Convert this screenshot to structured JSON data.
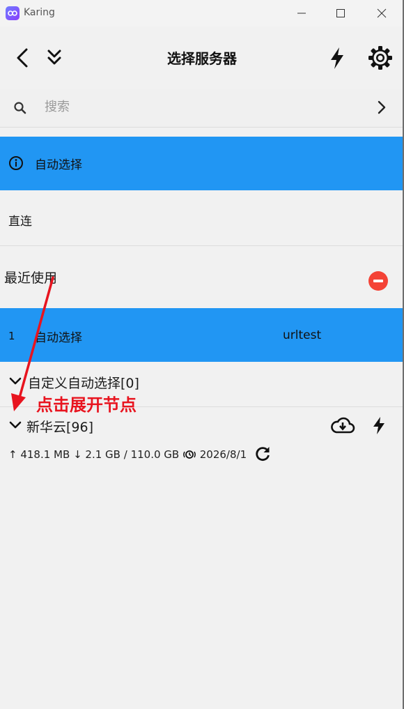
{
  "window": {
    "title": "Karing"
  },
  "header": {
    "title": "选择服务器"
  },
  "search": {
    "placeholder": "搜索"
  },
  "auto_select": {
    "label": "自动选择"
  },
  "direct": {
    "label": "直连"
  },
  "recent": {
    "label": "最近使用"
  },
  "recent_nodes": [
    {
      "index": "1",
      "name": "自动选择",
      "type": "urltest"
    }
  ],
  "groups": [
    {
      "label": "自定义自动选择[0]"
    },
    {
      "label": "新华云[96]",
      "upload": "↑ 418.1 MB",
      "download": "↓ 2.1 GB",
      "separator": "/",
      "total": "110.0 GB",
      "expire": "2026/8/1"
    }
  ],
  "annotation": {
    "text": "点击展开节点"
  },
  "colors": {
    "accent": "#2196f3",
    "danger": "#f44336",
    "annotation": "#e8141f",
    "background": "#f1f1f1"
  },
  "icons": [
    "back-icon",
    "collapse-all-icon",
    "bolt-icon",
    "gear-icon",
    "search-icon",
    "chevron-right-icon",
    "info-icon",
    "remove-icon",
    "chevron-down-icon",
    "cloud-download-icon",
    "clock-icon",
    "refresh-icon"
  ]
}
